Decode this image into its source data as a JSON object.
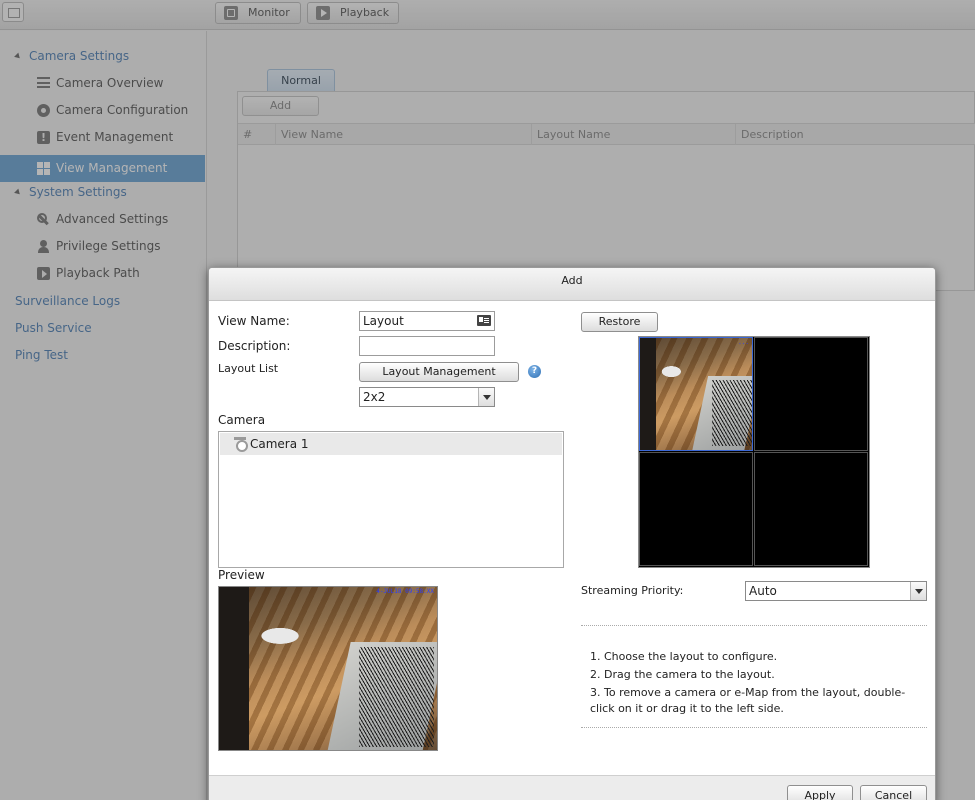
{
  "topbar": {
    "monitor_label": "Monitor",
    "playback_label": "Playback"
  },
  "sidebar": {
    "categories": [
      {
        "label": "Camera Settings",
        "items": [
          {
            "label": "Camera Overview",
            "icon": "list-icon"
          },
          {
            "label": "Camera Configuration",
            "icon": "camera-icon"
          },
          {
            "label": "Event Management",
            "icon": "event-icon"
          },
          {
            "label": "View Management",
            "icon": "grid-icon",
            "active": true
          }
        ]
      },
      {
        "label": "System Settings",
        "items": [
          {
            "label": "Advanced Settings",
            "icon": "wrench-icon"
          },
          {
            "label": "Privilege Settings",
            "icon": "user-icon"
          },
          {
            "label": "Playback Path",
            "icon": "playback-path-icon"
          }
        ]
      }
    ],
    "links": [
      "Surveillance Logs",
      "Push Service",
      "Ping Test"
    ]
  },
  "main": {
    "tab_label": "Normal",
    "add_label": "Add",
    "columns": [
      "#",
      "View Name",
      "Layout Name",
      "Description"
    ]
  },
  "dialog": {
    "title": "Add",
    "view_name_label": "View Name:",
    "view_name_value": "Layout",
    "description_label": "Description:",
    "description_value": "",
    "layout_list_label": "Layout List",
    "layout_management_label": "Layout Management",
    "help_glyph": "?",
    "layout_selected": "2x2",
    "camera_label": "Camera",
    "cameras": [
      "Camera 1"
    ],
    "preview_label": "Preview",
    "preview_timestamp": "4-JUL18 09:58:XX",
    "grid_timestamp": "...",
    "restore_label": "Restore",
    "streaming_priority_label": "Streaming Priority:",
    "streaming_priority_value": "Auto",
    "instructions": [
      "1. Choose the layout to configure.",
      "2. Drag the camera to the layout.",
      "3. To remove a camera or e-Map from the layout, double-click on it or drag it to the left side."
    ],
    "apply_label": "Apply",
    "cancel_label": "Cancel"
  },
  "colors": {
    "accent": "#6aa3d3",
    "link": "#4d7fb5",
    "grid_bg": "#000000"
  }
}
